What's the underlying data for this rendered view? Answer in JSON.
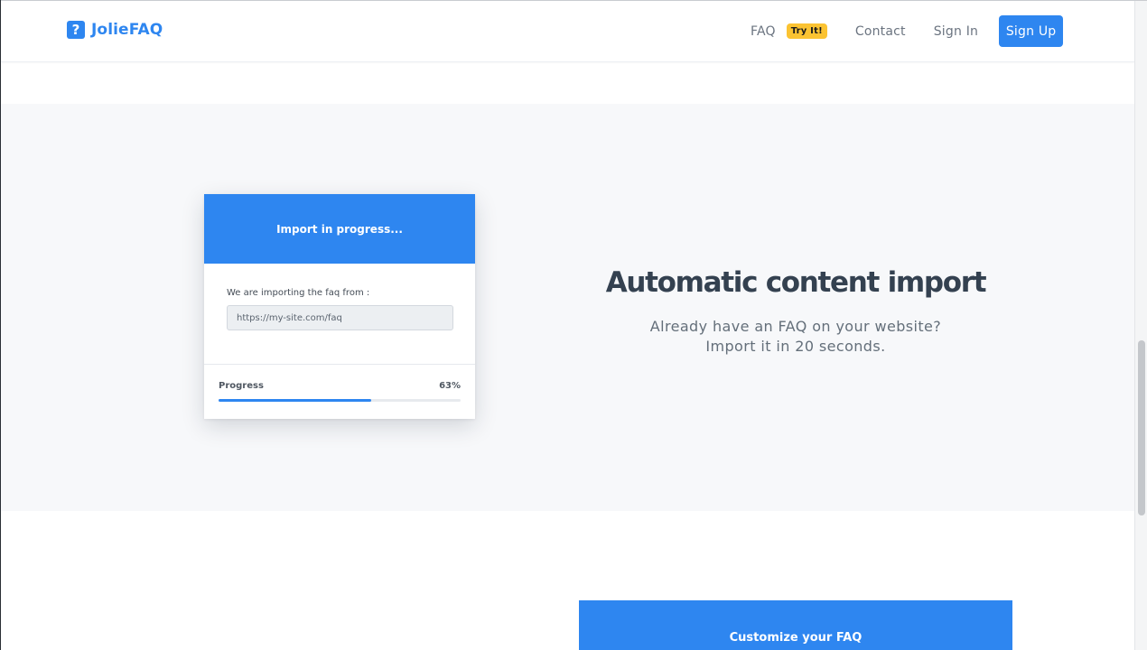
{
  "brand": {
    "icon_glyph": "?",
    "name": "JolieFAQ",
    "color": "#2e86f0"
  },
  "nav": {
    "faq_label": "FAQ",
    "faq_badge": "Try It!",
    "contact_label": "Contact",
    "signin_label": "Sign In",
    "signup_label": "Sign Up"
  },
  "import_card": {
    "title": "Import in progress...",
    "source_label": "We are importing the faq from :",
    "source_value": "https://my-site.com/faq",
    "progress_label": "Progress",
    "progress_text": "63%",
    "progress_fraction": 0.63
  },
  "feature": {
    "title": "Automatic content import",
    "subtitle_line1": "Already have an FAQ on your website?",
    "subtitle_line2": "Import it in 20 seconds."
  },
  "customize_card": {
    "title": "Customize your FAQ"
  },
  "colors": {
    "accent": "#2e86f0",
    "badge": "#fbc332",
    "section_bg": "#f7f8fa"
  }
}
